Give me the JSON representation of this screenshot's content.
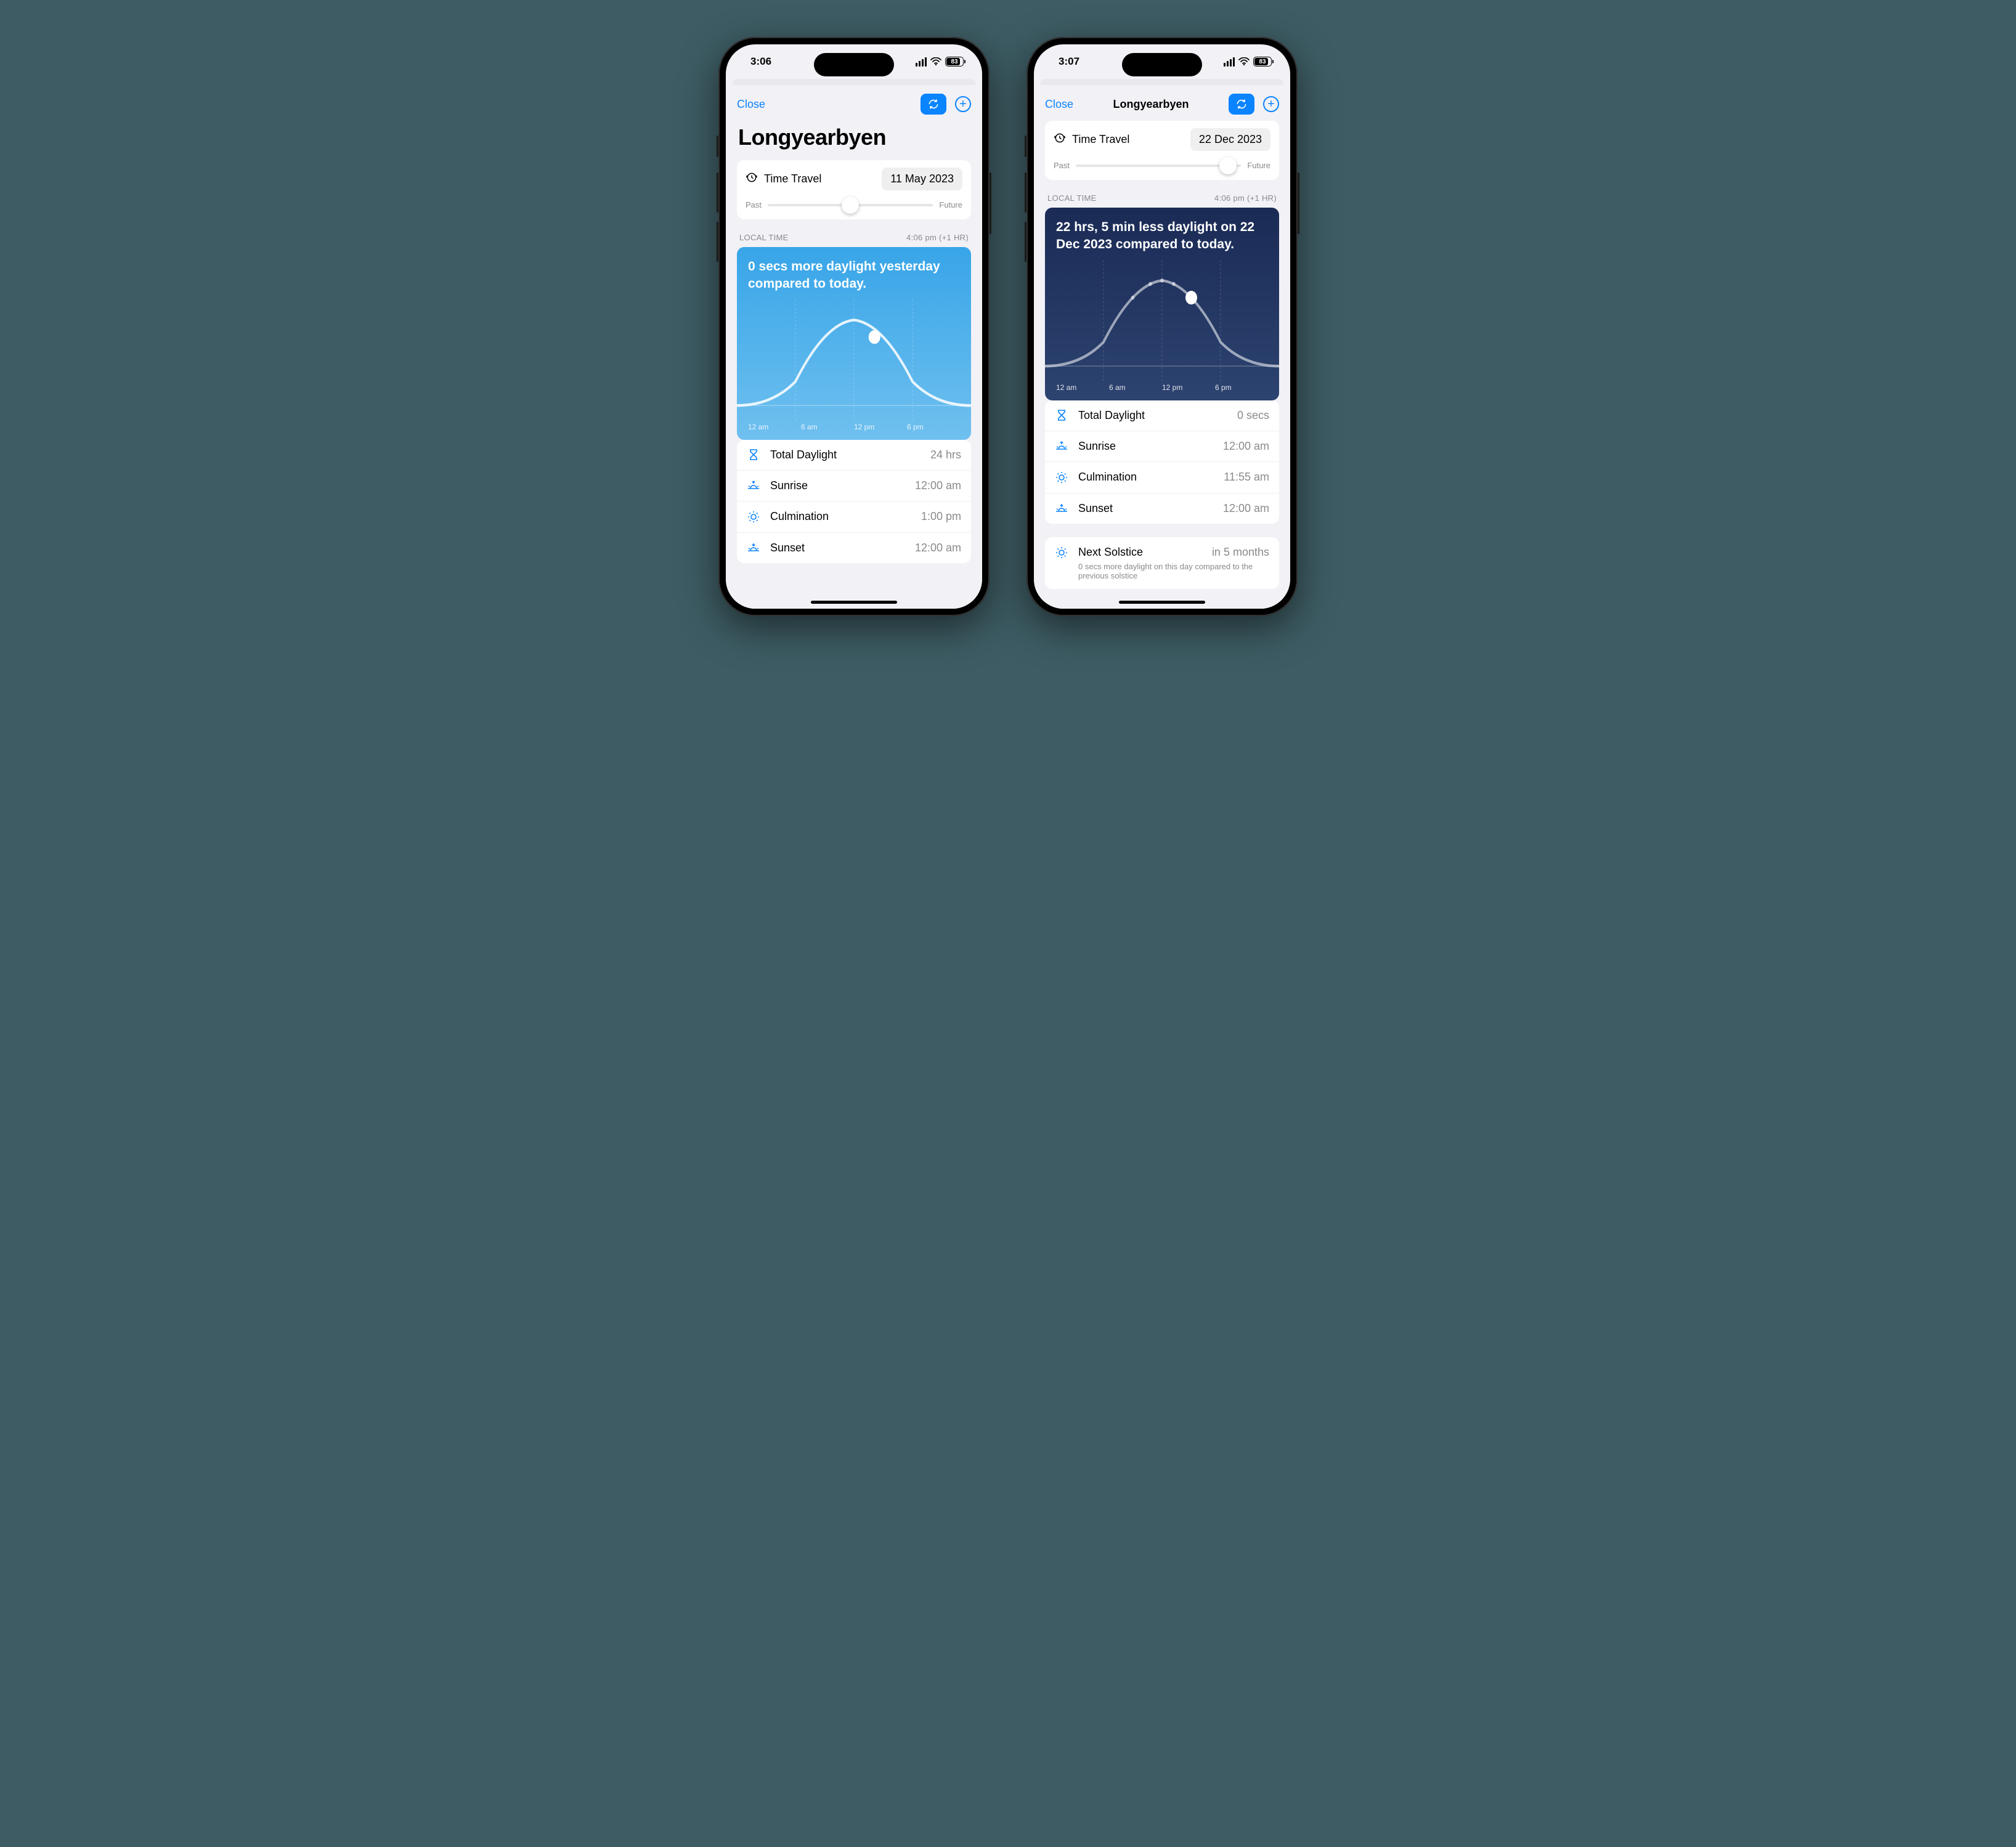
{
  "phones": [
    {
      "status": {
        "time": "3:06",
        "battery": "83"
      },
      "nav": {
        "close": "Close",
        "title_small": "",
        "show_big_title": true
      },
      "title": "Longyearbyen",
      "time_travel": {
        "label": "Time Travel",
        "date": "11 May 2023",
        "past": "Past",
        "future": "Future",
        "slider_pos": 50
      },
      "local_time": {
        "label": "LOCAL TIME",
        "value": "4:06 pm (+1 HR)"
      },
      "chart": {
        "theme": "day",
        "headline": "0 secs more daylight yesterday compared to today.",
        "labels": [
          "12 am",
          "6 am",
          "12 pm",
          "6 pm"
        ]
      },
      "rows": [
        {
          "icon": "hourglass",
          "label": "Total Daylight",
          "value": "24 hrs"
        },
        {
          "icon": "sunrise",
          "label": "Sunrise",
          "value": "12:00 am"
        },
        {
          "icon": "sun",
          "label": "Culmination",
          "value": "1:00 pm"
        },
        {
          "icon": "sunset",
          "label": "Sunset",
          "value": "12:00 am"
        }
      ],
      "next": null
    },
    {
      "status": {
        "time": "3:07",
        "battery": "83"
      },
      "nav": {
        "close": "Close",
        "title_small": "Longyearbyen",
        "show_big_title": false
      },
      "title": "Longyearbyen",
      "time_travel": {
        "label": "Time Travel",
        "date": "22 Dec 2023",
        "past": "Past",
        "future": "Future",
        "slider_pos": 92
      },
      "local_time": {
        "label": "LOCAL TIME",
        "value": "4:06 pm (+1 HR)"
      },
      "chart": {
        "theme": "night",
        "headline": "22 hrs, 5 min less daylight on 22 Dec 2023 compared to today.",
        "labels": [
          "12 am",
          "6 am",
          "12 pm",
          "6 pm"
        ]
      },
      "rows": [
        {
          "icon": "hourglass",
          "label": "Total Daylight",
          "value": "0 secs"
        },
        {
          "icon": "sunrise",
          "label": "Sunrise",
          "value": "12:00 am"
        },
        {
          "icon": "sun",
          "label": "Culmination",
          "value": "11:55 am"
        },
        {
          "icon": "sunset",
          "label": "Sunset",
          "value": "12:00 am"
        }
      ],
      "next": {
        "label": "Next Solstice",
        "value": "in 5 months",
        "sub": "0 secs more daylight on this day compared to the previous solstice"
      }
    }
  ],
  "chart_data": [
    {
      "type": "line",
      "title": "0 secs more daylight yesterday compared to today.",
      "xlabel": "",
      "ylabel": "",
      "categories": [
        "12 am",
        "6 am",
        "12 pm",
        "6 pm"
      ],
      "x": [
        0,
        3,
        6,
        9,
        12,
        15,
        18,
        21,
        24
      ],
      "values": [
        0,
        6,
        30,
        70,
        85,
        70,
        30,
        6,
        0
      ],
      "marker_x": 14,
      "marker_y": 78,
      "ylim": [
        0,
        100
      ]
    },
    {
      "type": "line",
      "title": "22 hrs, 5 min less daylight on 22 Dec 2023 compared to today.",
      "xlabel": "",
      "ylabel": "",
      "categories": [
        "12 am",
        "6 am",
        "12 pm",
        "6 pm"
      ],
      "x": [
        0,
        3,
        6,
        9,
        12,
        15,
        18,
        21,
        24
      ],
      "values": [
        0,
        6,
        30,
        70,
        85,
        70,
        30,
        6,
        0
      ],
      "marker_x": 15,
      "marker_y": 70,
      "ylim": [
        0,
        100
      ]
    }
  ]
}
